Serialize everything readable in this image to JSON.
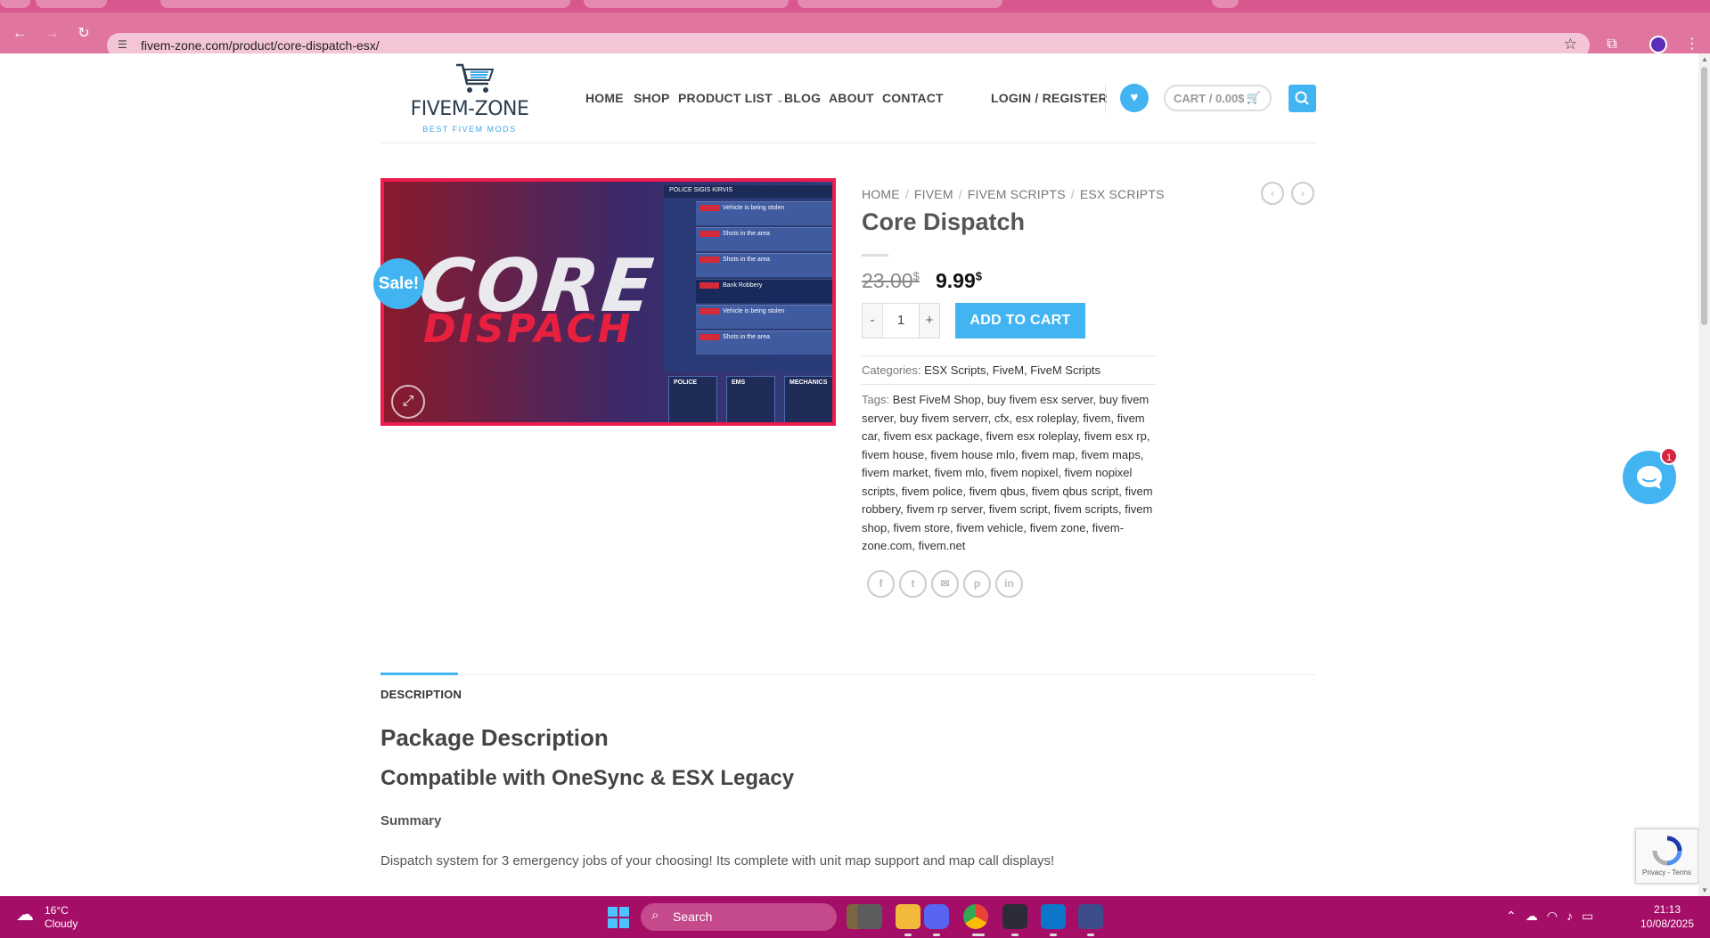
{
  "browser": {
    "url": "fivem-zone.com/product/core-dispatch-esx/",
    "theme_color": "#e0769f"
  },
  "header": {
    "logo_name": "FIVEM-ZONE",
    "logo_tagline": "BEST FIVEM MODS",
    "nav": [
      "HOME",
      "SHOP",
      "PRODUCT LIST",
      "BLOG",
      "ABOUT",
      "CONTACT"
    ],
    "login": "LOGIN / REGISTER",
    "cart": "CART / 0.00$",
    "accent": "#42b4f1"
  },
  "product": {
    "sale_badge": "Sale!",
    "image_words": [
      "CORE",
      "DISPACH"
    ],
    "image_panel_header": "POLICE  SIGIS KIRVIS",
    "image_calls": [
      "Vehicle is being stolen",
      "Shots in the area",
      "Shots in the area",
      "Bank Robbery",
      "Vehicle is being stolen",
      "Shots in the area"
    ],
    "image_units": [
      "POLICE",
      "EMS",
      "MECHANICS"
    ],
    "breadcrumb": [
      "HOME",
      "FIVEM",
      "FIVEM SCRIPTS",
      "ESX SCRIPTS"
    ],
    "title": "Core Dispatch",
    "price_old": "23.00",
    "price_new": "9.99",
    "currency": "$",
    "qty_minus": "-",
    "qty_value": "1",
    "qty_plus": "+",
    "add_to_cart": "ADD TO CART",
    "categories_label": "Categories:",
    "categories": "ESX Scripts, FiveM, FiveM Scripts",
    "tags_label": "Tags:",
    "tags": "Best FiveM Shop, buy fivem esx server, buy fivem server, buy fivem serverr, cfx, esx roleplay, fivem, fivem car, fivem esx package, fivem esx roleplay, fivem esx rp, fivem house, fivem house mlo, fivem map, fivem maps, fivem market, fivem mlo, fivem nopixel, fivem nopixel scripts, fivem police, fivem qbus, fivem qbus script, fivem robbery, fivem rp server, fivem script, fivem scripts, fivem shop, fivem store, fivem vehicle, fivem zone, fivem-zone.com, fivem.net",
    "share_icons": [
      "facebook-icon",
      "twitter-icon",
      "email-icon",
      "pinterest-icon",
      "linkedin-icon"
    ]
  },
  "description": {
    "tab": "DESCRIPTION",
    "heading1": "Package Description",
    "heading2": "Compatible with OneSync & ESX Legacy",
    "summary_label": "Summary",
    "summary_text": "Dispatch system for 3 emergency jobs of your choosing! Its complete with unit map support and map call displays!"
  },
  "chat": {
    "badge_count": "1"
  },
  "recaptcha": {
    "text": "Privacy - Terms"
  },
  "taskbar": {
    "temp": "16°C",
    "condition": "Cloudy",
    "search": "Search",
    "time": "21:13",
    "date": "10/08/2025",
    "color": "#a40e67"
  }
}
